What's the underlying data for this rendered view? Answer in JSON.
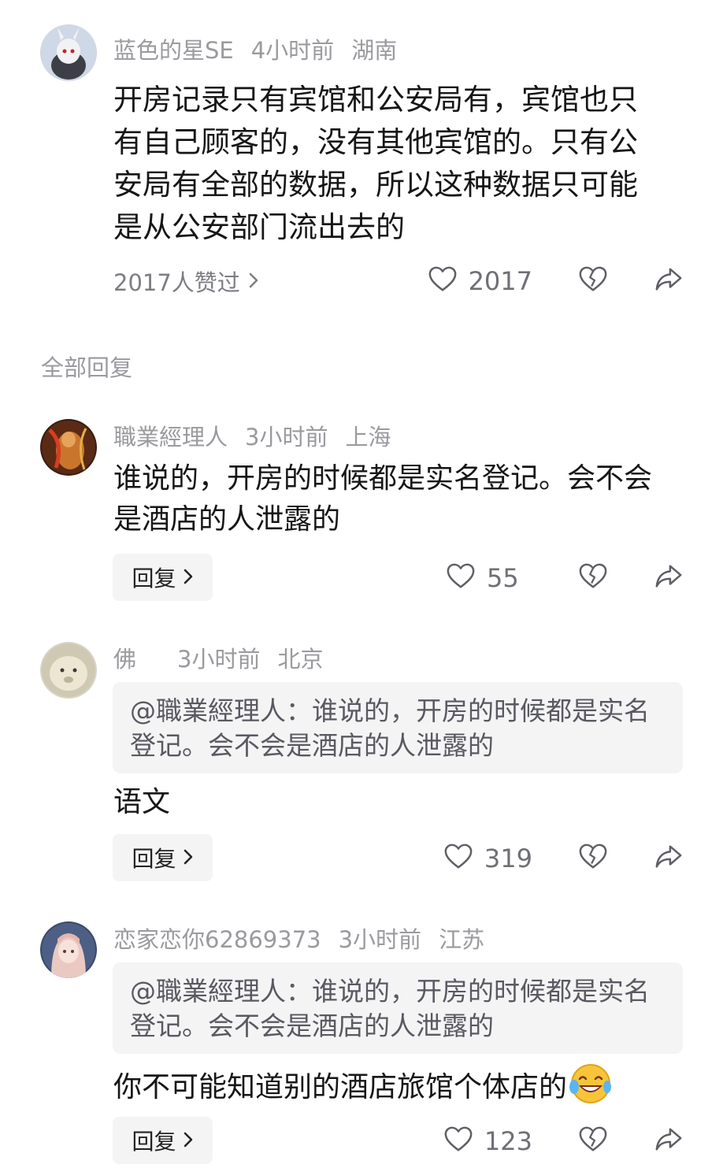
{
  "main_comment": {
    "username": "蓝色的星SE",
    "time": "4小时前",
    "location": "湖南",
    "text": "开房记录只有宾馆和公安局有，宾馆也只有自己顾客的，没有其他宾馆的。只有公安局有全部的数据，所以这种数据只可能是从公安部门流出去的",
    "likes_link": "2017人赞过",
    "like_count": "2017"
  },
  "section_title": "全部回复",
  "replies": [
    {
      "username": "職業經理人",
      "time": "3小时前",
      "location": "上海",
      "quote": "",
      "text": "谁说的，开房的时候都是实名登记。会不会是酒店的人泄露的",
      "reply_label": "回复",
      "like_count": "55"
    },
    {
      "username": "佛",
      "time": "3小时前",
      "location": "北京",
      "quote": "@職業經理人：谁说的，开房的时候都是实名登记。会不会是酒店的人泄露的",
      "text": "语文",
      "reply_label": "回复",
      "like_count": "319"
    },
    {
      "username": "恋家恋你62869373",
      "time": "3小时前",
      "location": "江苏",
      "quote": "@職業經理人：谁说的，开房的时候都是实名登记。会不会是酒店的人泄露的",
      "text": "你不可能知道别的酒店旅馆个体店的",
      "emoji": "laughing-crying-emoji",
      "reply_label": "回复",
      "like_count": "123"
    }
  ],
  "icons": {
    "like": "heart-outline-icon",
    "dislike": "broken-heart-icon",
    "share": "share-arrow-icon",
    "chevron": "chevron-right-icon"
  },
  "colors": {
    "meta_gray": "#9a9a9f",
    "text_dark": "#161616",
    "quote_bg": "#f4f4f5",
    "icon_gray": "#5e5e66"
  }
}
